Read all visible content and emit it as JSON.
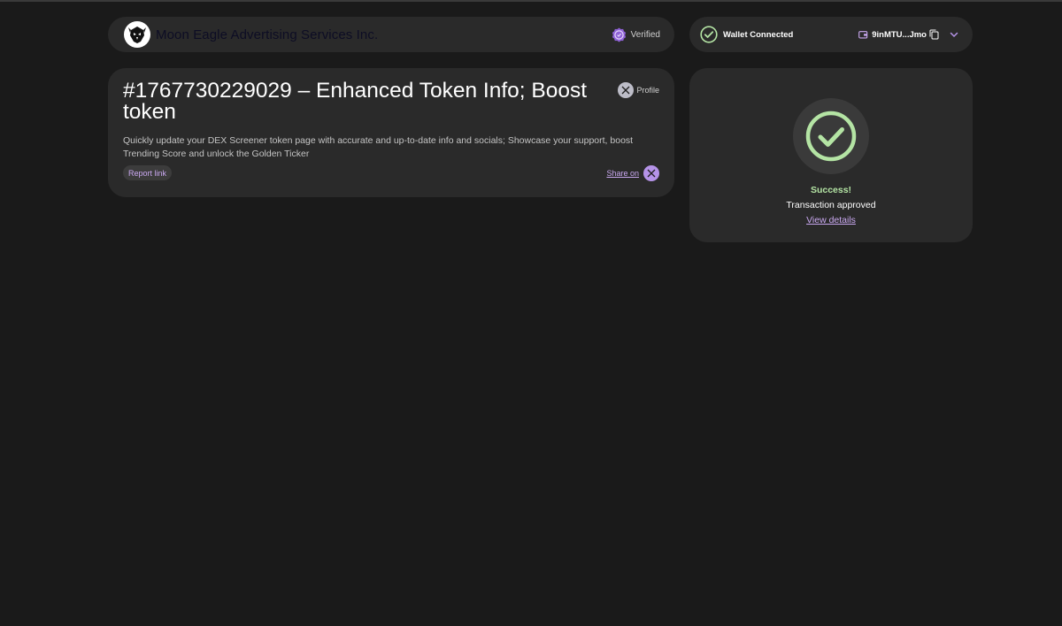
{
  "header": {
    "merchant_name": "Moon Eagle Advertising Services Inc.",
    "verified_label": "Verified",
    "wallet_label": "Wallet Connected",
    "wallet_address": "9inMTU...Jmo"
  },
  "order": {
    "title": "#1767730229029 – Enhanced Token Info; Boost token",
    "profile_label": "Profile",
    "description": "Quickly update your DEX Screener token page with accurate and up-to-date info and socials; Showcase your support, boost Trending Score and unlock the Golden Ticker",
    "report_label": "Report link",
    "share_label": "Share on"
  },
  "status": {
    "title": "Success!",
    "subtitle": "Transaction approved",
    "details_link": "View details"
  },
  "colors": {
    "background": "#1a1a1a",
    "card": "#2a2a2a",
    "accent_purple": "#b593e8",
    "success_green": "#b4e4a4"
  },
  "icons": {
    "logo": "eagle-logo-icon",
    "verified": "verified-badge-icon",
    "wallet_status": "check-circle-icon",
    "wallet": "wallet-icon",
    "copy": "copy-icon",
    "menu": "chevron-down-icon",
    "social": "x-icon",
    "success": "check-circle-icon"
  }
}
